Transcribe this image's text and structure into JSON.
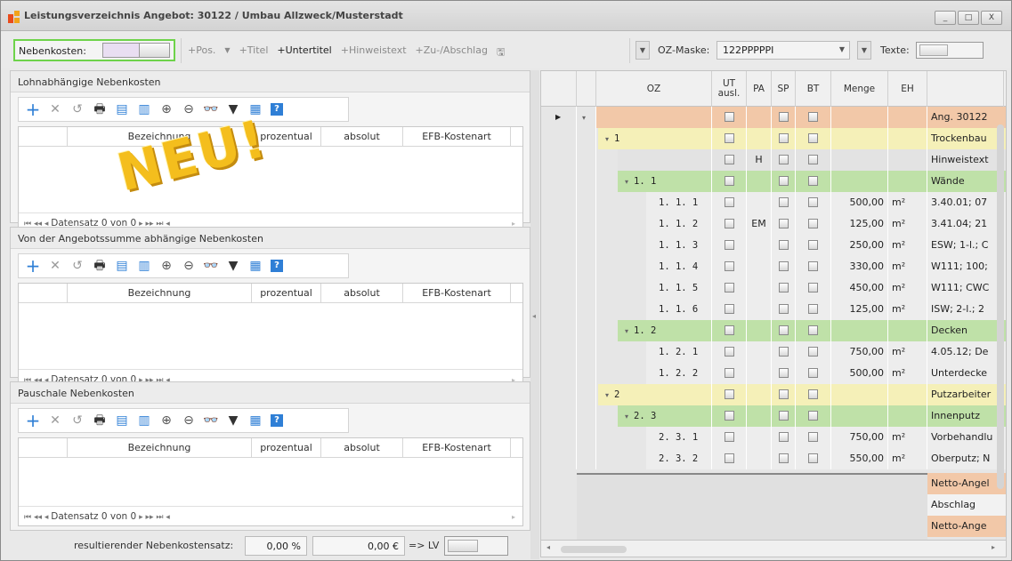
{
  "window": {
    "title": "Leistungsverzeichnis Angebot: 30122 / Umbau Allzweck/Musterstadt",
    "buttons": [
      "_",
      "□",
      "X"
    ]
  },
  "toolbar": {
    "nebenkosten_label": "Nebenkosten:",
    "pos": "+Pos.",
    "titel": "+Titel",
    "untertitel": "+Untertitel",
    "hinweistext": "+Hinweistext",
    "zuabschlag": "+Zu-/Abschlag",
    "oz_mask_label": "OZ-Maske:",
    "oz_mask_value": "122PPPPPI",
    "texte_label": "Texte:"
  },
  "panels": [
    {
      "title": "Lohnabhängige Nebenkosten",
      "columns": [
        "Bezeichnung",
        "prozentual",
        "absolut",
        "EFB-Kostenart"
      ],
      "nav": "Datensatz 0 von 0"
    },
    {
      "title": "Von der Angebotssumme abhängige Nebenkosten",
      "columns": [
        "Bezeichnung",
        "prozentual",
        "absolut",
        "EFB-Kostenart"
      ],
      "nav": "Datensatz 0 von 0"
    },
    {
      "title": "Pauschale Nebenkosten",
      "columns": [
        "Bezeichnung",
        "prozentual",
        "absolut",
        "EFB-Kostenart"
      ],
      "nav": "Datensatz 0 von 0"
    }
  ],
  "overlay": {
    "neu": "NEU!"
  },
  "footer": {
    "label": "resultierender Nebenkostensatz:",
    "percent": "0,00 %",
    "amount": "0,00 €",
    "to_lv": "=> LV"
  },
  "table": {
    "headers": [
      "OZ",
      "UT ausl.",
      "PA",
      "SP",
      "BT",
      "Menge",
      "EH",
      ""
    ],
    "rows": [
      {
        "oz": "",
        "pa": "",
        "menge": "",
        "eh": "",
        "text": "Ang. 30122",
        "color": "#f2c8a8",
        "indent": 0,
        "expander": "▾"
      },
      {
        "oz": "1",
        "pa": "",
        "menge": "",
        "eh": "",
        "text": "Trockenbau",
        "color": "#f5f0b8",
        "indent": 1,
        "expander": "▾"
      },
      {
        "oz": "",
        "pa": "H",
        "menge": "",
        "eh": "",
        "text": "Hinweistext",
        "color": "#e3e3e3",
        "indent": 2,
        "expander": ""
      },
      {
        "oz": "1. 1",
        "pa": "",
        "menge": "",
        "eh": "",
        "text": "Wände",
        "color": "#bfe1a8",
        "indent": 2,
        "expander": "▾"
      },
      {
        "oz": "1. 1.  1",
        "pa": "",
        "menge": "500,00",
        "eh": "m²",
        "text": "3.40.01; 07",
        "color": "#ededed",
        "indent": 3,
        "expander": ""
      },
      {
        "oz": "1. 1.  2",
        "pa": "EM",
        "menge": "125,00",
        "eh": "m²",
        "text": "3.41.04; 21",
        "color": "#ededed",
        "indent": 3,
        "expander": ""
      },
      {
        "oz": "1. 1.  3",
        "pa": "",
        "menge": "250,00",
        "eh": "m²",
        "text": "ESW; 1-l.; C",
        "color": "#ededed",
        "indent": 3,
        "expander": ""
      },
      {
        "oz": "1. 1.  4",
        "pa": "",
        "menge": "330,00",
        "eh": "m²",
        "text": "W111; 100;",
        "color": "#ededed",
        "indent": 3,
        "expander": ""
      },
      {
        "oz": "1. 1.  5",
        "pa": "",
        "menge": "450,00",
        "eh": "m²",
        "text": "W111; CWC",
        "color": "#ededed",
        "indent": 3,
        "expander": ""
      },
      {
        "oz": "1. 1.  6",
        "pa": "",
        "menge": "125,00",
        "eh": "m²",
        "text": "ISW; 2-l.; 2",
        "color": "#ededed",
        "indent": 3,
        "expander": ""
      },
      {
        "oz": "1. 2",
        "pa": "",
        "menge": "",
        "eh": "",
        "text": "Decken",
        "color": "#bfe1a8",
        "indent": 2,
        "expander": "▾"
      },
      {
        "oz": "1. 2.  1",
        "pa": "",
        "menge": "750,00",
        "eh": "m²",
        "text": "4.05.12; De",
        "color": "#ededed",
        "indent": 3,
        "expander": ""
      },
      {
        "oz": "1. 2.  2",
        "pa": "",
        "menge": "500,00",
        "eh": "m²",
        "text": "Unterdecke",
        "color": "#ededed",
        "indent": 3,
        "expander": ""
      },
      {
        "oz": "2",
        "pa": "",
        "menge": "",
        "eh": "",
        "text": "Putzarbeiter",
        "color": "#f5f0b8",
        "indent": 1,
        "expander": "▾"
      },
      {
        "oz": "2. 3",
        "pa": "",
        "menge": "",
        "eh": "",
        "text": "Innenputz",
        "color": "#bfe1a8",
        "indent": 2,
        "expander": "▾"
      },
      {
        "oz": "2. 3.  1",
        "pa": "",
        "menge": "750,00",
        "eh": "m²",
        "text": "Vorbehandlu",
        "color": "#ededed",
        "indent": 3,
        "expander": ""
      },
      {
        "oz": "2. 3.  2",
        "pa": "",
        "menge": "550,00",
        "eh": "m²",
        "text": "Oberputz; N",
        "color": "#ededed",
        "indent": 3,
        "expander": ""
      }
    ],
    "summary": [
      {
        "text": "Netto-Angel",
        "color": "#f2c8a8"
      },
      {
        "text": "Abschlag",
        "color": "#f2f2f2"
      },
      {
        "text": "Netto-Ange",
        "color": "#f2c8a8"
      }
    ]
  },
  "colors": {
    "accent_green": "#6ed34a",
    "neu_yellow": "#f4be1d",
    "plus_blue": "#2f7fd6"
  }
}
